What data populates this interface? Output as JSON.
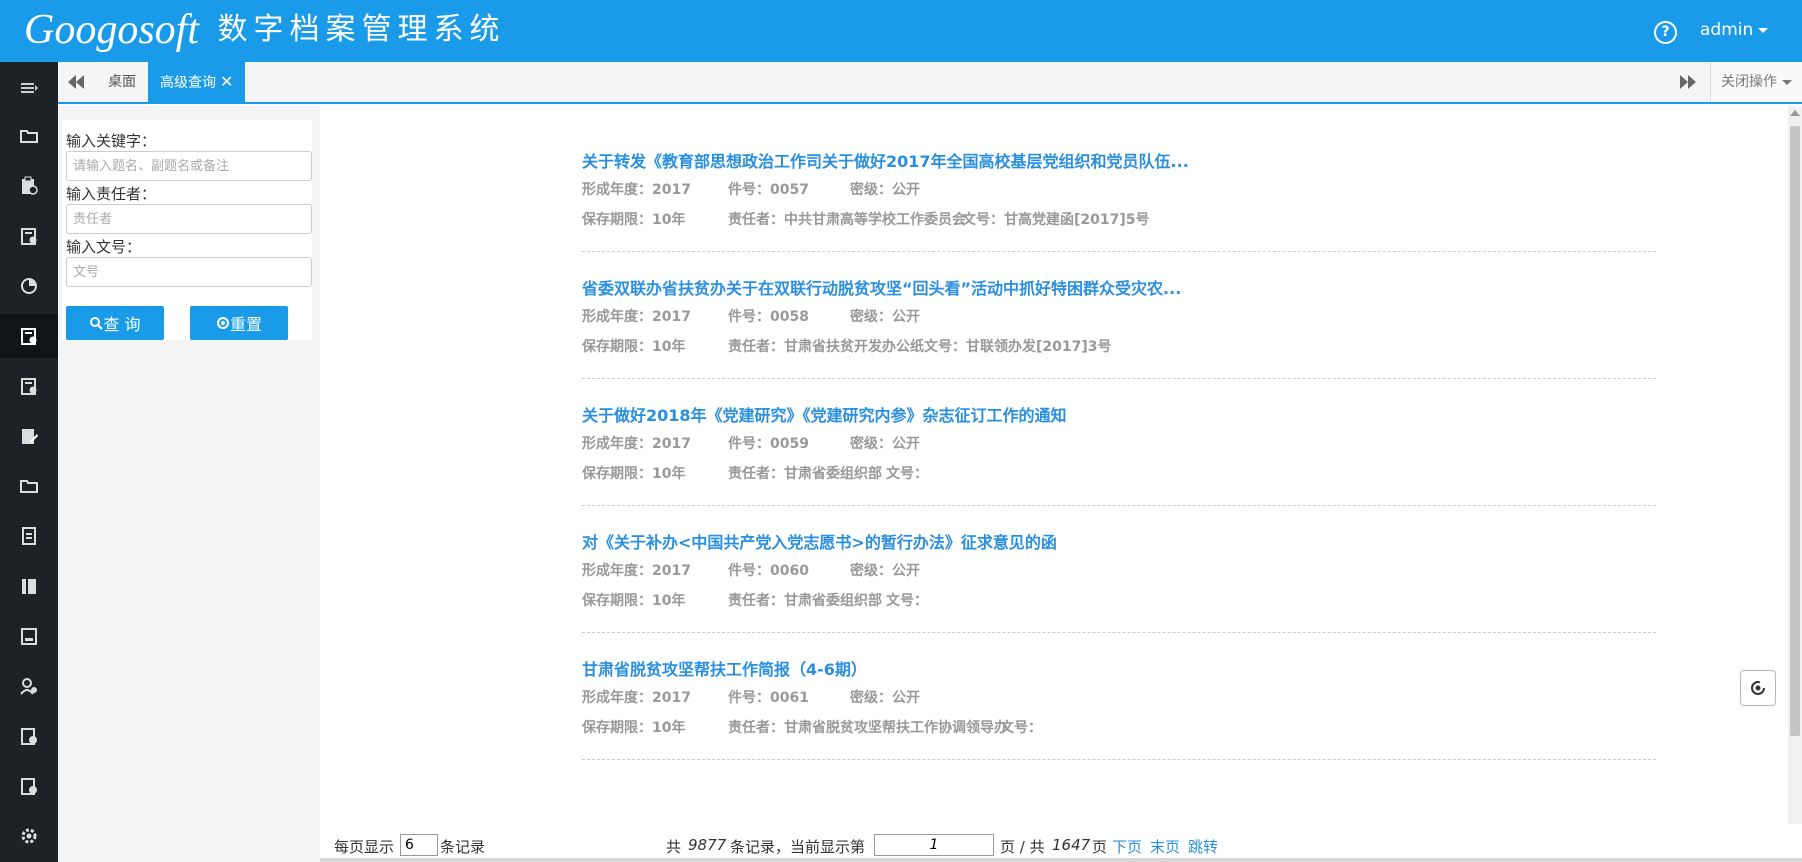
{
  "app": {
    "brand_latin": "Googosoft",
    "brand_cn": "数字档案管理系统",
    "help_label": "?",
    "user": "admin"
  },
  "tabs": {
    "home": "桌面",
    "active": "高级查询",
    "close_glyph": "✕",
    "close_ops": "关闭操作"
  },
  "search": {
    "keyword_label": "输入关键字：",
    "keyword_placeholder": "请输入题名、副题名或备注",
    "owner_label": "输入责任者：",
    "owner_placeholder": "责任者",
    "docno_label": "输入文号：",
    "docno_placeholder": "文号",
    "query_button": "查 询",
    "reset_button": "重置"
  },
  "records": [
    {
      "title": "关于转发《教育部思想政治工作司关于做好2017年全国高校基层党组织和党员队伍...",
      "year": "形成年度：2017",
      "item": "件号：0057",
      "secret": "密级：公开",
      "retention": "保存期限：10年",
      "owner": "责任者：中共甘肃高等学校工作委员会",
      "docno": "文号：甘高党建函[2017]5号"
    },
    {
      "title": "省委双联办省扶贫办关于在双联行动脱贫攻坚“回头看”活动中抓好特困群众受灾农...",
      "year": "形成年度：2017",
      "item": "件号：0058",
      "secret": "密级：公开",
      "retention": "保存期限：10年",
      "owner": "责任者：甘肃省扶贫开发办公纸",
      "docno": "文号：甘联领办发[2017]3号"
    },
    {
      "title": "关于做好2018年《党建研究》《党建研究内参》杂志征订工作的通知",
      "year": "形成年度：2017",
      "item": "件号：0059",
      "secret": "密级：公开",
      "retention": "保存期限：10年",
      "owner": "责任者：甘肃省委组织部",
      "docno": "文号："
    },
    {
      "title": "对《关于补办<中国共产党入党志愿书>的暂行办法》征求意见的函",
      "year": "形成年度：2017",
      "item": "件号：0060",
      "secret": "密级：公开",
      "retention": "保存期限：10年",
      "owner": "责任者：甘肃省委组织部",
      "docno": "文号："
    },
    {
      "title": "甘肃省脱贫攻坚帮扶工作简报（4-6期）",
      "year": "形成年度：2017",
      "item": "件号：0061",
      "secret": "密级：公开",
      "retention": "保存期限：10年",
      "owner": "责任者：甘肃省脱贫攻坚帮扶工作协调领导办",
      "docno": "文号："
    }
  ],
  "pager": {
    "per_page_prefix": "每页显示",
    "per_page_value": "6",
    "per_page_suffix": "条记录",
    "total_prefix": "共",
    "total_count": "9877",
    "total_mid": "条记录，当前显示第",
    "current_page": "1",
    "pages_prefix": "页 / 共",
    "total_pages": "1647",
    "pages_suffix": "页",
    "next": "下页",
    "last": "末页",
    "jump": "跳转"
  },
  "colors": {
    "header": "#1a9bea",
    "sidebar": "#1e2227",
    "link": "#2a8fe0",
    "meta": "#999999"
  },
  "sidebar_icons": [
    "menu-toggle-icon",
    "folder-icon",
    "archive-clipboard-icon",
    "archive-box-icon",
    "pie-chart-icon",
    "archive-box-active-icon",
    "archive-box-icon",
    "edit-document-icon",
    "folder-icon",
    "document-list-icon",
    "book-icon",
    "form-icon",
    "user-settings-icon",
    "certificate-icon",
    "certificate-check-icon",
    "gear-icon"
  ]
}
